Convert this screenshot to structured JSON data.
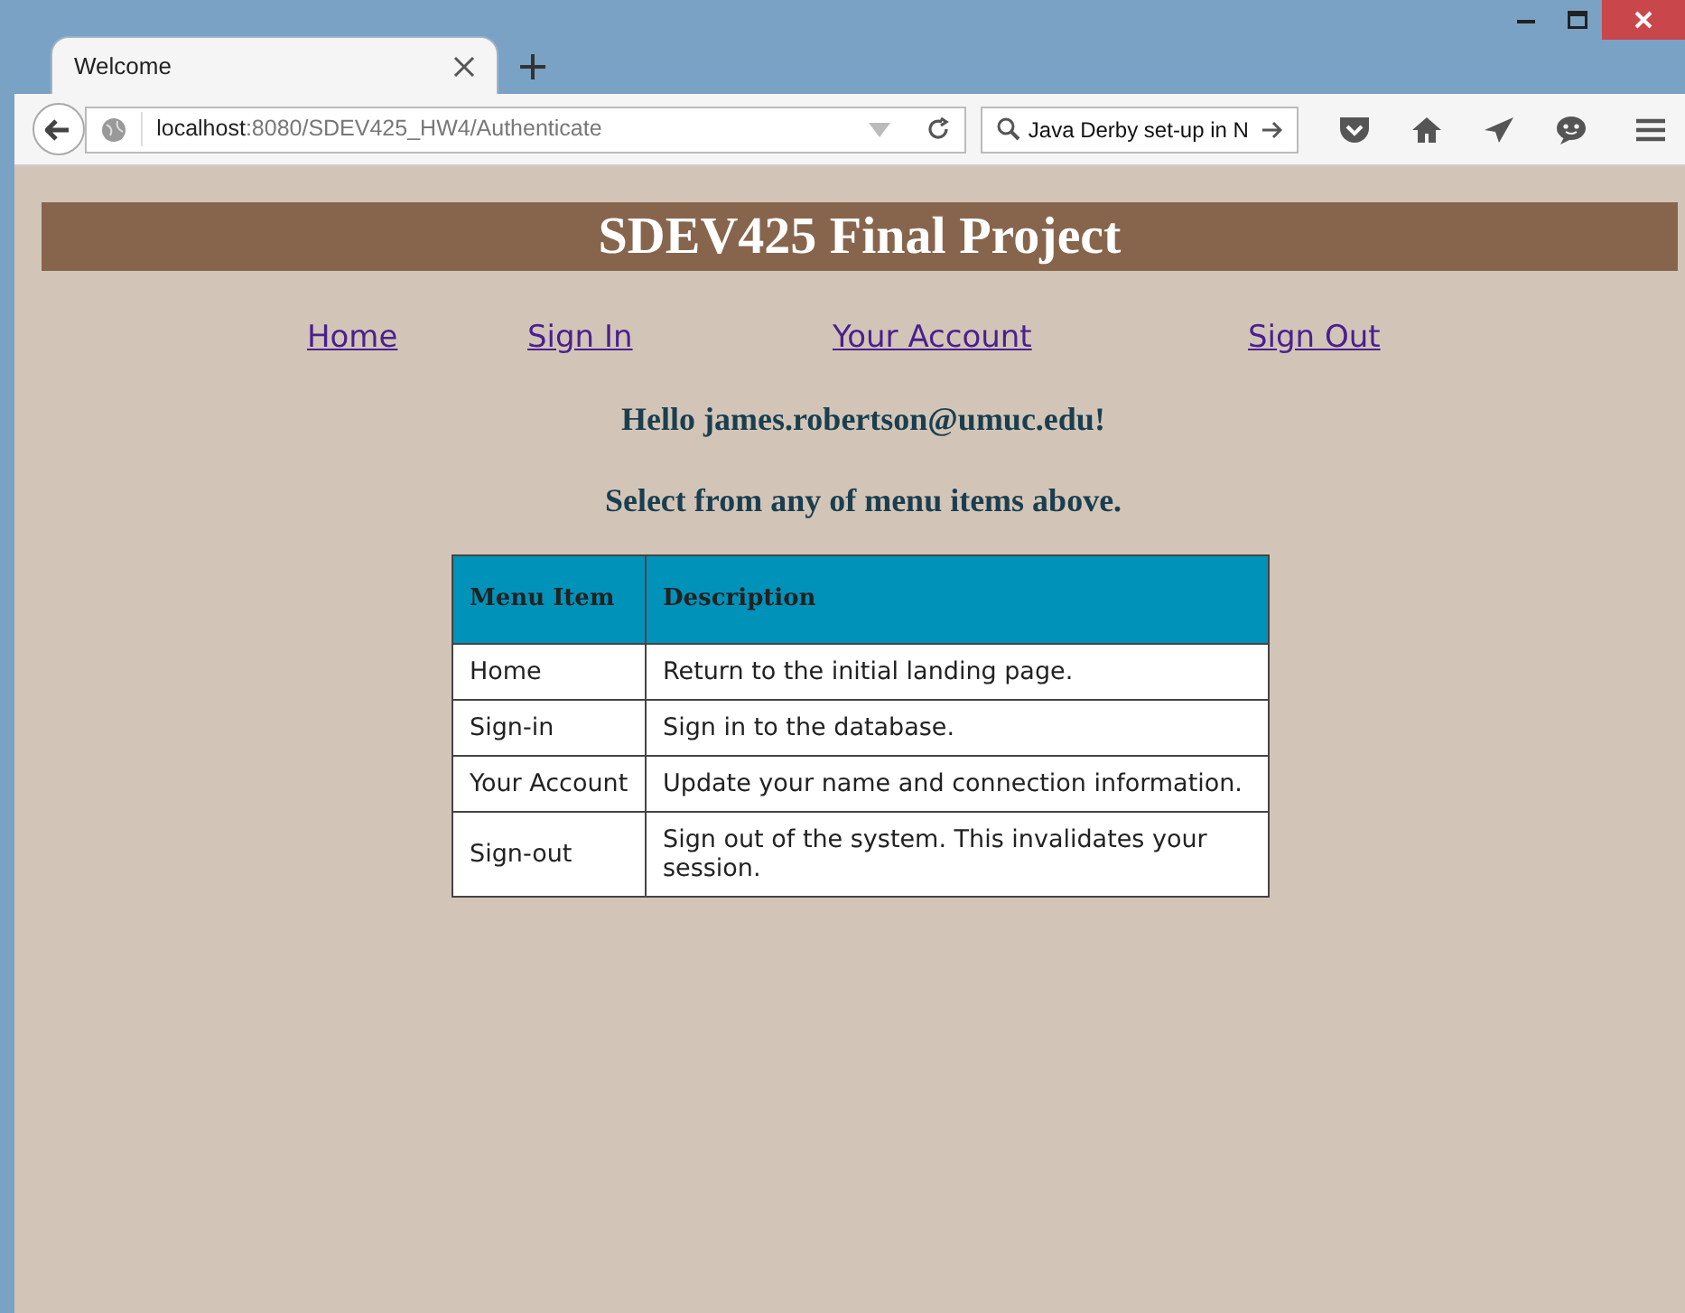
{
  "tab": {
    "title": "Welcome",
    "selected": true
  },
  "address": {
    "host": "localhost",
    "path": ":8080/SDEV425_HW4/Authenticate"
  },
  "search": {
    "value": "Java Derby set-up in N"
  },
  "page": {
    "heading": "SDEV425 Final Project",
    "nav": [
      "Home",
      "Sign In",
      "Your Account",
      "Sign Out"
    ],
    "greeting": "Hello james.robertson@umuc.edu!",
    "instruction": "Select from any of menu items above.",
    "table": {
      "columns": [
        "Menu Item",
        "Description"
      ],
      "rows": [
        [
          "Home",
          "Return to the initial landing page."
        ],
        [
          "Sign-in",
          "Sign in to the database."
        ],
        [
          "Your Account",
          "Update your name and connection information."
        ],
        [
          "Sign-out",
          "Sign out of the system. This invalidates your session."
        ]
      ]
    }
  }
}
